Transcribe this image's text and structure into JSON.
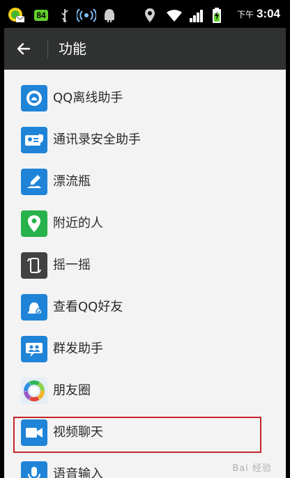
{
  "status_bar": {
    "notification_badge": "84",
    "period": "下午",
    "time": "3:04",
    "icons": [
      "qq-notification-icon",
      "mail-icon",
      "usb-icon",
      "wireless-hotspot-icon",
      "android-debug-icon",
      "location-icon",
      "wifi-icon",
      "signal-icon",
      "battery-charging-icon"
    ]
  },
  "header": {
    "back_icon": "arrow-left-icon",
    "title": "功能"
  },
  "list": {
    "items": [
      {
        "label": "QQ离线助手",
        "icon": "qq-offline-assistant-icon",
        "color": "#1f84d8"
      },
      {
        "label": "通讯录安全助手",
        "icon": "contacts-security-icon",
        "color": "#1f84d8"
      },
      {
        "label": "漂流瓶",
        "icon": "drift-bottle-icon",
        "color": "#1f84d8"
      },
      {
        "label": "附近的人",
        "icon": "nearby-people-icon",
        "color": "#27b24c"
      },
      {
        "label": "摇一摇",
        "icon": "shake-icon",
        "color": "#424242"
      },
      {
        "label": "查看QQ好友",
        "icon": "view-qq-friends-icon",
        "color": "#1f84d8"
      },
      {
        "label": "群发助手",
        "icon": "broadcast-assistant-icon",
        "color": "#1f84d8"
      },
      {
        "label": "朋友圈",
        "icon": "moments-icon",
        "color": "#e4eef7"
      },
      {
        "label": "视频聊天",
        "icon": "video-chat-icon",
        "color": "#1f84d8",
        "highlighted": true
      },
      {
        "label": "语音输入",
        "icon": "voice-input-icon",
        "color": "#1f84d8"
      }
    ]
  },
  "highlight_color": "#c4262a",
  "watermark": "Bai 经验"
}
